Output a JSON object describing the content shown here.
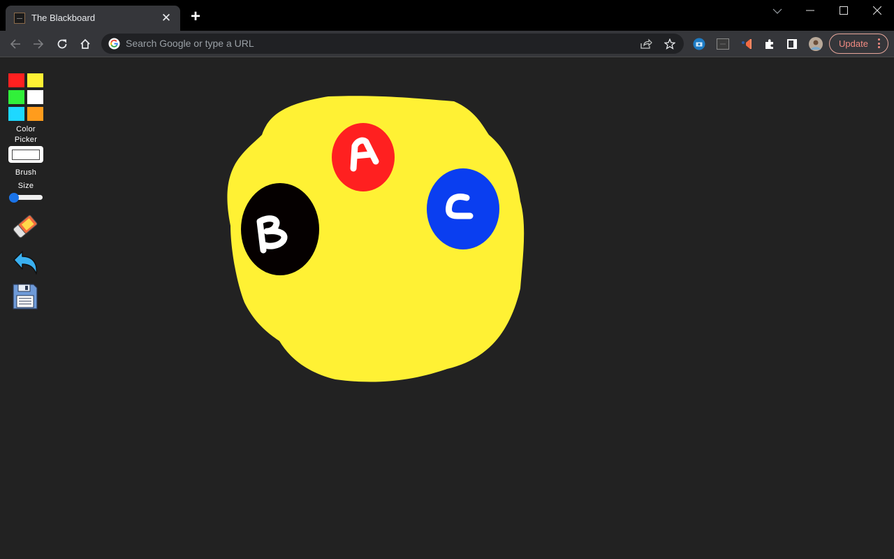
{
  "browser": {
    "tab": {
      "title": "The Blackboard",
      "close_glyph": "✕",
      "favicon": "blackboard-favicon"
    },
    "new_tab_glyph": "+",
    "window_controls": {
      "tab_search": "⌵",
      "minimize": "—",
      "maximize": "☐",
      "close": "✕"
    },
    "omnibox": {
      "placeholder": "Search Google or type a URL",
      "value": ""
    },
    "update_button": {
      "label": "Update"
    },
    "extensions": [
      "photo-extension-icon",
      "blackboard-extension-icon",
      "announcer-extension-icon",
      "puzzle-extensions-icon",
      "side-panel-icon",
      "profile-avatar"
    ]
  },
  "app": {
    "palette": [
      {
        "name": "red",
        "color": "#ff2020"
      },
      {
        "name": "yellow",
        "color": "#fff134"
      },
      {
        "name": "green",
        "color": "#31f03a"
      },
      {
        "name": "white",
        "color": "#ffffff"
      },
      {
        "name": "cyan",
        "color": "#1ed8ff"
      },
      {
        "name": "orange",
        "color": "#ff9c1c"
      }
    ],
    "color_picker_label_1": "Color",
    "color_picker_label_2": "Picker",
    "color_picker_value": "#ffffff",
    "brush_label_1": "Brush",
    "brush_label_2": "Size",
    "brush_size_fraction": 0.0,
    "tools": [
      "eraser",
      "undo",
      "save"
    ]
  },
  "drawing": {
    "background": "#222222",
    "shapes": [
      {
        "name": "big-yellow-blob",
        "color": "#fff134"
      },
      {
        "name": "circle-a",
        "color": "#ff2020",
        "letter": "A"
      },
      {
        "name": "circle-b",
        "color": "#050000",
        "letter": "B"
      },
      {
        "name": "circle-c",
        "color": "#0a3ef0",
        "letter": "C"
      }
    ],
    "letter_color": "#ffffff"
  }
}
